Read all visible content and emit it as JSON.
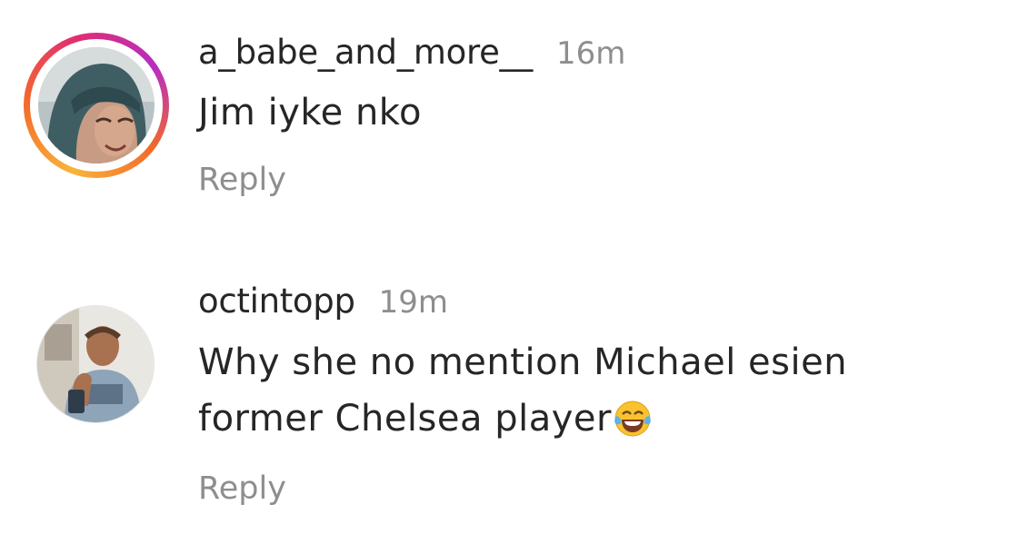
{
  "comments": [
    {
      "username": "a_babe_and_more__",
      "time": "16m",
      "text": "Jim iyke nko",
      "reply_label": "Reply",
      "has_story_ring": true
    },
    {
      "username": "octintopp",
      "time": "19m",
      "text_line1": "Why she no mention Michael esien",
      "text_line2": "former Chelsea player",
      "emoji": "face-with-tears-of-joy-icon",
      "reply_label": "Reply",
      "has_story_ring": false
    }
  ],
  "colors": {
    "text_primary": "#262626",
    "text_secondary": "#8e8e8e",
    "story_ring_start": "#f8b43a",
    "story_ring_end": "#b62ec1"
  }
}
